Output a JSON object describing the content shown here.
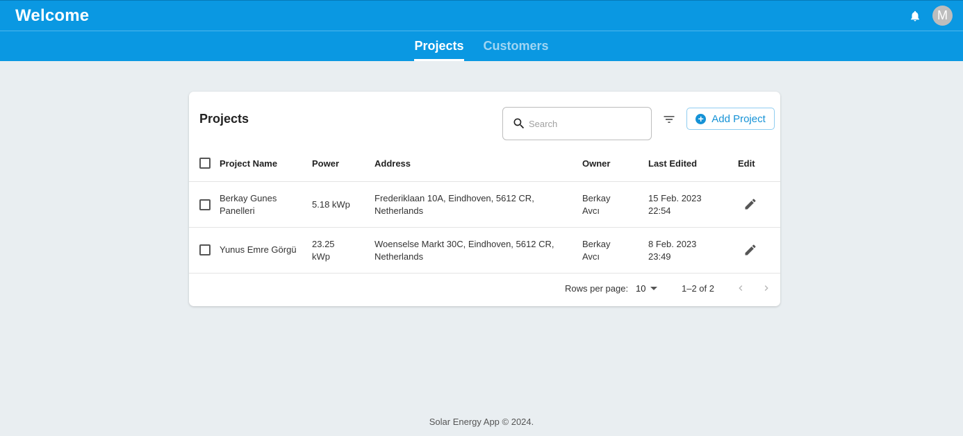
{
  "appbar": {
    "title": "Welcome",
    "avatar_initial": "M"
  },
  "tabs": [
    {
      "label": "Projects",
      "active": true
    },
    {
      "label": "Customers",
      "active": false
    }
  ],
  "card": {
    "title": "Projects",
    "search_placeholder": "Search",
    "add_label": "Add Project"
  },
  "table": {
    "headers": [
      "Project Name",
      "Power",
      "Address",
      "Owner",
      "Last Edited",
      "Edit"
    ],
    "rows": [
      {
        "name_line1": "Berkay Gunes",
        "name_line2": "Panelleri",
        "power_line1": "5.18 kWp",
        "power_line2": "",
        "address_line1": "Frederiklaan 10A, Eindhoven, 5612 CR,",
        "address_line2": "Netherlands",
        "owner_line1": "Berkay",
        "owner_line2": "Avcı",
        "edited_line1": "15 Feb. 2023",
        "edited_line2": "22:54"
      },
      {
        "name_line1": "Yunus Emre Görgü",
        "name_line2": "",
        "power_line1": "23.25",
        "power_line2": "kWp",
        "address_line1": "Woenselse Markt 30C, Eindhoven, 5612 CR,",
        "address_line2": "Netherlands",
        "owner_line1": "Berkay",
        "owner_line2": "Avcı",
        "edited_line1": "8 Feb. 2023",
        "edited_line2": "23:49"
      }
    ]
  },
  "pagination": {
    "rows_per_page_label": "Rows per page:",
    "rows_per_page_value": "10",
    "range": "1–2 of 2"
  },
  "footer": {
    "copyright": "Solar Energy App © 2024."
  },
  "colors": {
    "primary": "#0a98e2",
    "accent": "#1592d6",
    "background": "#e9eef1"
  },
  "icons": [
    "bell-icon",
    "search-icon",
    "filter-icon",
    "plus-circle-icon",
    "pencil-icon",
    "chevron-left-icon",
    "chevron-right-icon",
    "caret-down-icon"
  ]
}
